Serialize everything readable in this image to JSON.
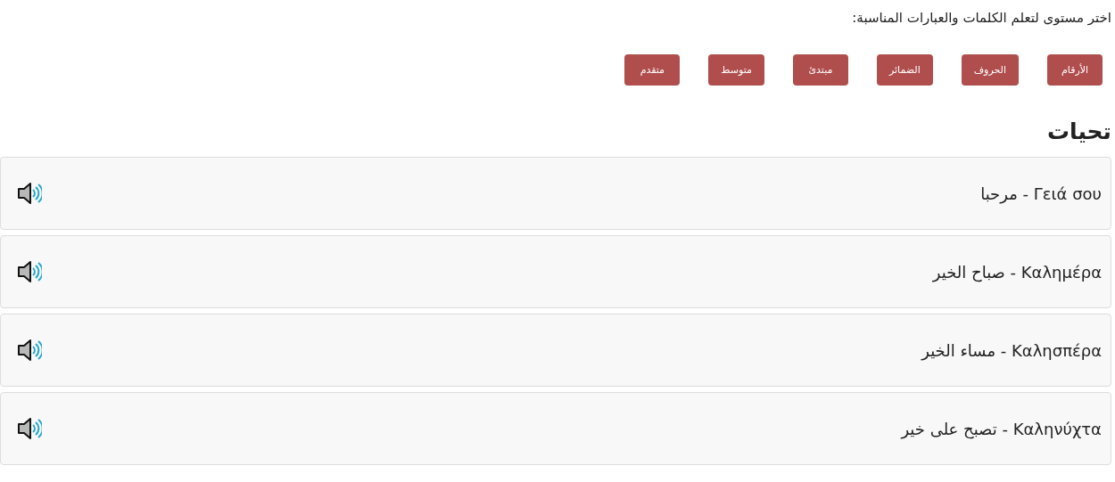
{
  "intro": "اختر مستوى لتعلم الكلمات والعبارات المناسبة:",
  "levels": [
    {
      "label": "الأرقام"
    },
    {
      "label": "الحروف"
    },
    {
      "label": "الضمائر"
    },
    {
      "label": "مبتدئ"
    },
    {
      "label": "متوسط"
    },
    {
      "label": "متقدم"
    }
  ],
  "section": {
    "title": "تحيات",
    "phrases": [
      {
        "text": "Γειά σου - مرحبا"
      },
      {
        "text": "Καλημέρα - صباح الخير"
      },
      {
        "text": "Καλησπέρα - مساء الخير"
      },
      {
        "text": "Καληνύχτα - تصبح على خير"
      }
    ]
  }
}
